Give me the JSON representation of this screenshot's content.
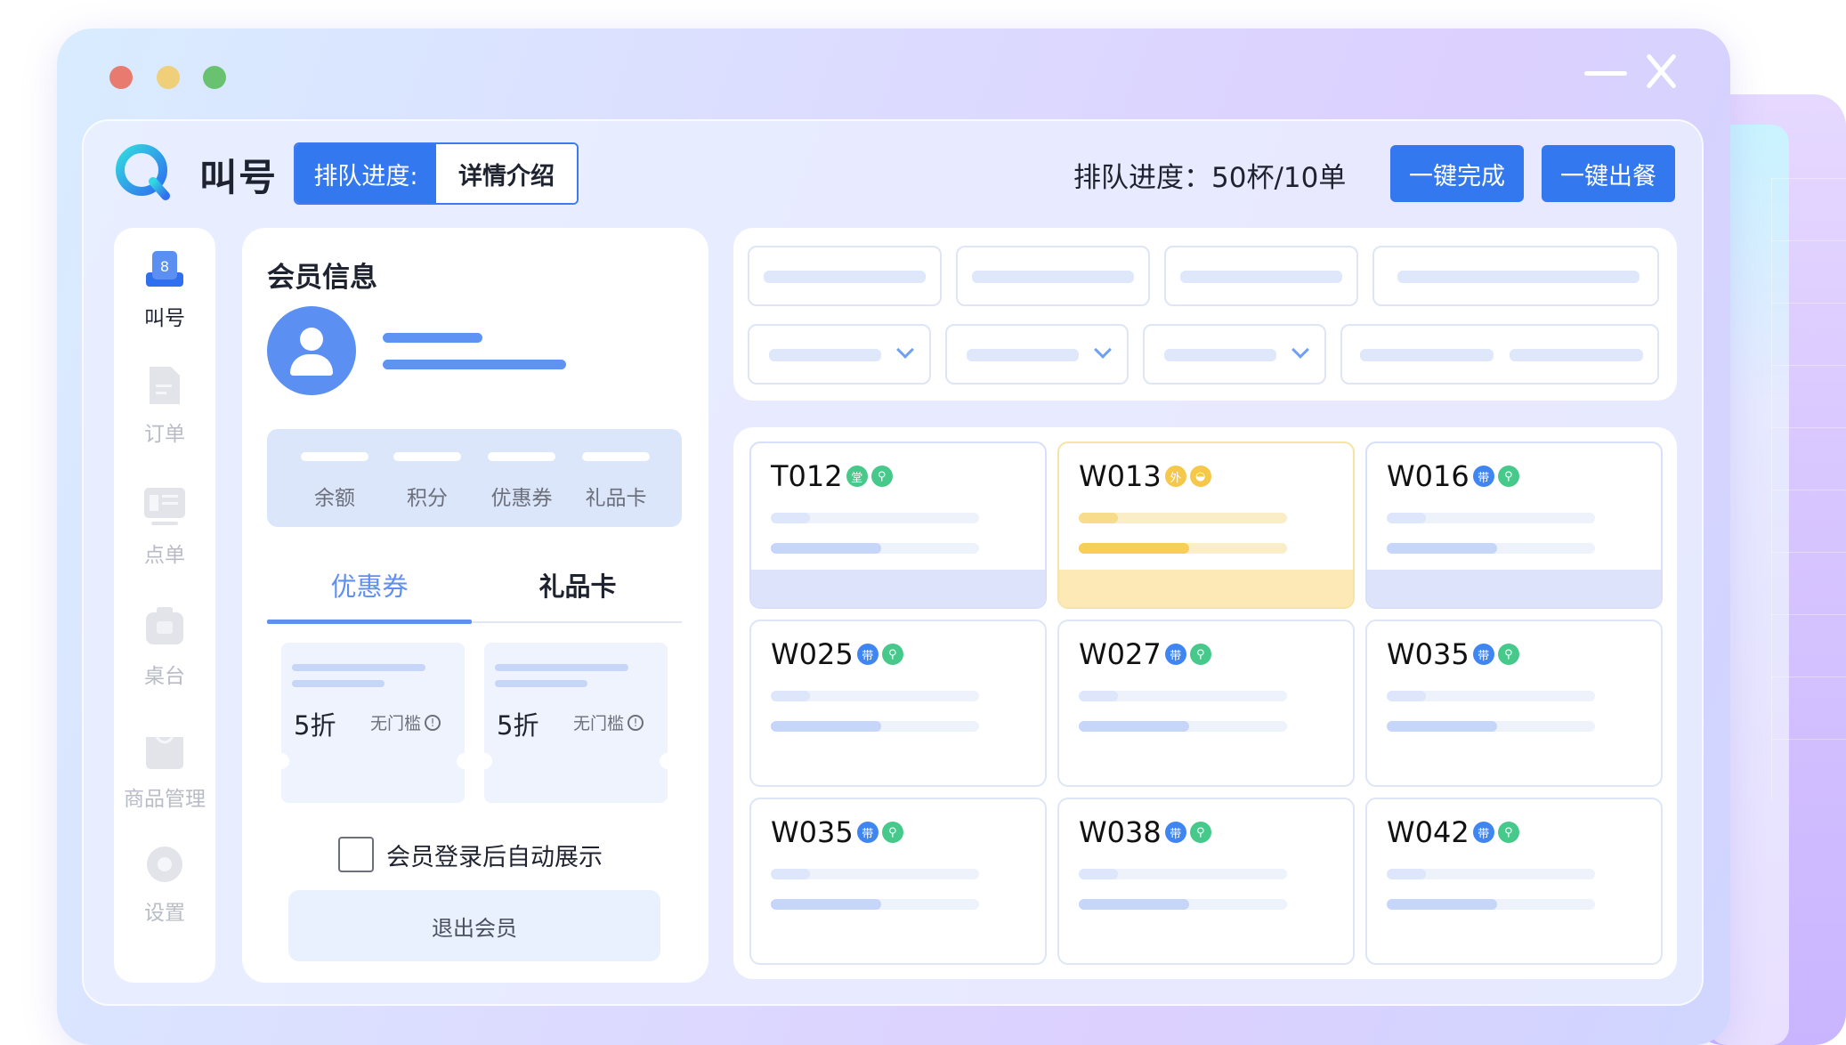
{
  "window": {
    "title": "叫号",
    "segment": {
      "label": "排队进度:",
      "detail": "详情介绍"
    },
    "queue_progress": "排队进度：50杯/10单",
    "buttons": {
      "complete_all": "一键完成",
      "serve_all": "一键出餐"
    }
  },
  "sidebar": {
    "items": [
      {
        "label": "叫号",
        "icon": "call-number-icon",
        "active": true
      },
      {
        "label": "订单",
        "icon": "order-document-icon",
        "active": false
      },
      {
        "label": "点单",
        "icon": "menu-icon",
        "active": false
      },
      {
        "label": "桌台",
        "icon": "table-icon",
        "active": false
      },
      {
        "label": "商品管理",
        "icon": "product-box-icon",
        "active": false
      },
      {
        "label": "设置",
        "icon": "gear-icon",
        "active": false
      }
    ]
  },
  "member": {
    "title": "会员信息",
    "stats": [
      "余额",
      "积分",
      "优惠券",
      "礼品卡"
    ],
    "tabs": [
      "优惠券",
      "礼品卡"
    ],
    "coupons": [
      {
        "value": "5折",
        "note": "无门槛"
      },
      {
        "value": "5折",
        "note": "无门槛"
      }
    ],
    "auto_show_label": "会员登录后自动展示",
    "logout_label": "退出会员"
  },
  "orders": [
    {
      "code": "T012",
      "tags": [
        {
          "text": "堂",
          "color": "#46c98b"
        },
        {
          "text": "⚲",
          "color": "#46c98b"
        }
      ],
      "style": "blue"
    },
    {
      "code": "W013",
      "tags": [
        {
          "text": "外",
          "color": "#f5c84a"
        },
        {
          "text": "◒",
          "color": "#f5c84a"
        }
      ],
      "style": "yellow"
    },
    {
      "code": "W016",
      "tags": [
        {
          "text": "带",
          "color": "#3f86f2"
        },
        {
          "text": "⚲",
          "color": "#46c98b"
        }
      ],
      "style": "blue"
    },
    {
      "code": "W025",
      "tags": [
        {
          "text": "带",
          "color": "#3f86f2"
        },
        {
          "text": "⚲",
          "color": "#46c98b"
        }
      ],
      "style": "plain"
    },
    {
      "code": "W027",
      "tags": [
        {
          "text": "带",
          "color": "#3f86f2"
        },
        {
          "text": "⚲",
          "color": "#46c98b"
        }
      ],
      "style": "plain"
    },
    {
      "code": "W035",
      "tags": [
        {
          "text": "带",
          "color": "#3f86f2"
        },
        {
          "text": "⚲",
          "color": "#46c98b"
        }
      ],
      "style": "plain"
    },
    {
      "code": "W035",
      "tags": [
        {
          "text": "带",
          "color": "#3f86f2"
        },
        {
          "text": "⚲",
          "color": "#46c98b"
        }
      ],
      "style": "plain"
    },
    {
      "code": "W038",
      "tags": [
        {
          "text": "带",
          "color": "#3f86f2"
        },
        {
          "text": "⚲",
          "color": "#46c98b"
        }
      ],
      "style": "plain"
    },
    {
      "code": "W042",
      "tags": [
        {
          "text": "带",
          "color": "#3f86f2"
        },
        {
          "text": "⚲",
          "color": "#46c98b"
        }
      ],
      "style": "plain"
    }
  ],
  "colors": {
    "accent": "#3478f0",
    "panel": "#ffffff"
  }
}
